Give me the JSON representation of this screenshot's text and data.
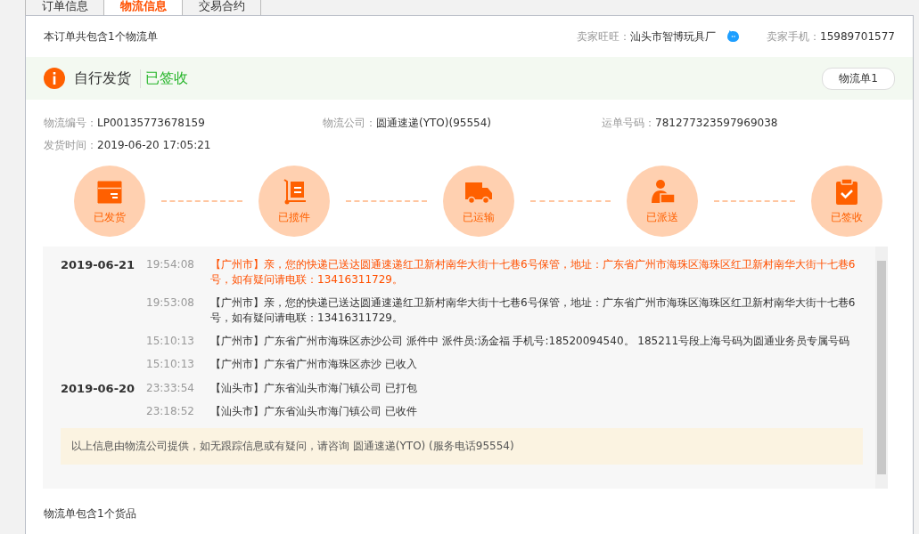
{
  "tabs": [
    {
      "label": "订单信息",
      "selected": false
    },
    {
      "label": "物流信息",
      "selected": true
    },
    {
      "label": "交易合约",
      "selected": false
    }
  ],
  "summary": {
    "text": "本订单共包含1个物流单",
    "seller_wangwang_label": "卖家旺旺：",
    "seller_wangwang": "汕头市智博玩具厂",
    "seller_phone_label": "卖家手机：",
    "seller_phone": "15989701577"
  },
  "banner": {
    "method": "自行发货",
    "status": "已签收",
    "waybill_button": "物流单1"
  },
  "details": [
    {
      "label": "物流编号：",
      "value": "LP00135773678159"
    },
    {
      "label": "物流公司：",
      "value": "圆通速递(YTO)(95554)"
    },
    {
      "label": "运单号码：",
      "value": "781277323597969038"
    },
    {
      "label": "发货时间：",
      "value": "2019-06-20 17:05:21"
    }
  ],
  "steps": [
    {
      "label": "已发货",
      "kind": "box"
    },
    {
      "label": "已揽件",
      "kind": "trolley"
    },
    {
      "label": "已运输",
      "kind": "truck"
    },
    {
      "label": "已派送",
      "kind": "courier"
    },
    {
      "label": "已签收",
      "kind": "clipboard"
    }
  ],
  "trace": [
    {
      "date": "2019-06-21",
      "events": [
        {
          "time": "19:54:08",
          "text": "【广州市】亲，您的快递已送达圆通速递红卫新村南华大街十七巷6号保管，地址：广东省广州市海珠区海珠区红卫新村南华大街十七巷6号，如有疑问请电联：13416311729。",
          "latest": true
        },
        {
          "time": "19:53:08",
          "text": "【广州市】亲，您的快递已送达圆通速递红卫新村南华大街十七巷6号保管，地址：广东省广州市海珠区海珠区红卫新村南华大街十七巷6号，如有疑问请电联：13416311729。",
          "latest": false
        },
        {
          "time": "15:10:13",
          "text": "【广州市】广东省广州市海珠区赤沙公司 派件中 派件员:汤金福 手机号:18520094540。 185211号段上海号码为圆通业务员专属号码",
          "latest": false
        },
        {
          "time": "15:10:13",
          "text": "【广州市】广东省广州市海珠区赤沙 已收入",
          "latest": false
        }
      ]
    },
    {
      "date": "2019-06-20",
      "events": [
        {
          "time": "23:33:54",
          "text": "【汕头市】广东省汕头市海门镇公司 已打包",
          "latest": false
        },
        {
          "time": "23:18:52",
          "text": "【汕头市】广东省汕头市海门镇公司 已收件",
          "latest": false
        }
      ]
    }
  ],
  "notice": "以上信息由物流公司提供，如无跟踪信息或有疑问，请咨询 圆通速递(YTO) (服务电话95554)",
  "footer": "物流单包含1个货品"
}
